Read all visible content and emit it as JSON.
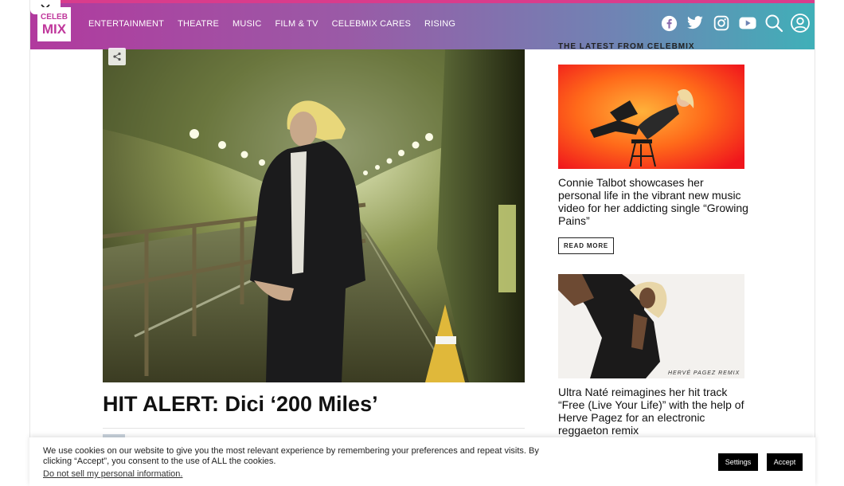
{
  "header": {
    "logo_line1": "CELEB",
    "logo_line2": "MIX",
    "nav": [
      "ENTERTAINMENT",
      "THEATRE",
      "MUSIC",
      "FILM & TV",
      "CELEBMIX CARES",
      "RISING"
    ],
    "icons": [
      "facebook-icon",
      "twitter-icon",
      "instagram-icon",
      "youtube-icon",
      "search-icon",
      "user-icon"
    ]
  },
  "article": {
    "headline": "HIT ALERT: Dici ‘200 Miles’"
  },
  "sidebar": {
    "heading": "THE LATEST FROM CELEBMIX",
    "cards": [
      {
        "title": "Connie Talbot showcases her personal life in the vibrant new music video for her addicting single “Growing Pains”",
        "button": "READ MORE"
      },
      {
        "title": "Ultra Naté reimagines her hit track “Free (Live Your Life)” with the help of Herve Pagez for an electronic reggaeton remix",
        "image_caption": "HERVÉ PAGEZ REMIX"
      }
    ]
  },
  "cookie": {
    "text": "We use cookies on our website to give you the most relevant experience by remembering your preferences and repeat visits. By clicking “Accept”, you consent to the use of ALL the cookies.",
    "link": "Do not sell my personal information",
    "link_suffix": ".",
    "settings": "Settings",
    "accept": "Accept"
  },
  "colors": {
    "brand": "#c0389c",
    "header_start": "#b13a9e",
    "header_end": "#3fb0b8"
  }
}
